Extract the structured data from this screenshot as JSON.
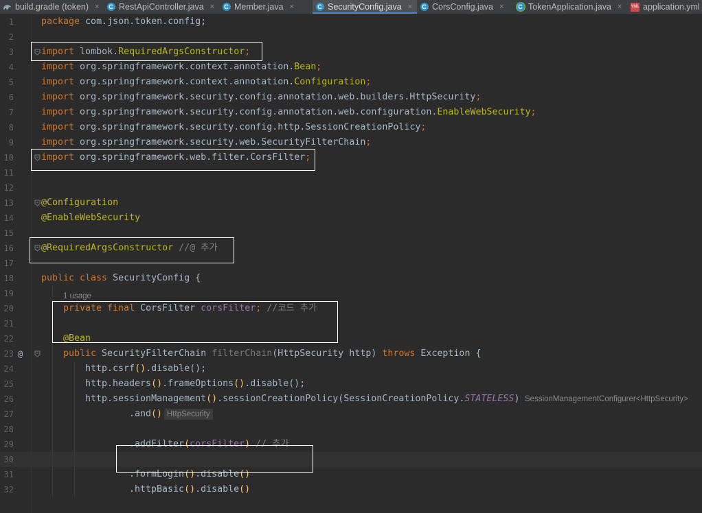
{
  "tabs": [
    {
      "label": "build.gradle (token)",
      "icon": "gradle-icon",
      "active": false
    },
    {
      "label": "RestApiController.java",
      "icon": "class-icon",
      "active": false
    },
    {
      "label": "Member.java",
      "icon": "class-icon",
      "active": false
    },
    {
      "label": "SecurityConfig.java",
      "icon": "class-icon",
      "active": true
    },
    {
      "label": "CorsConfig.java",
      "icon": "class-icon",
      "active": false
    },
    {
      "label": "TokenApplication.java",
      "icon": "spring-boot-class-icon",
      "active": false
    },
    {
      "label": "application.yml",
      "icon": "yml-file-icon",
      "active": false
    }
  ],
  "close_glyph": "×",
  "class_icon_letter": "C",
  "yml_icon_text": "YML",
  "gutter_at_symbol": "@",
  "editor": {
    "line_numbers": [
      "1",
      "2",
      "3",
      "4",
      "5",
      "6",
      "7",
      "8",
      "9",
      "10",
      "11",
      "12",
      "13",
      "14",
      "15",
      "16",
      "17",
      "18",
      "19",
      "20",
      "21",
      "22",
      "23",
      "24",
      "25",
      "26",
      "27",
      "28",
      "29",
      "30",
      "31",
      "32"
    ],
    "usage_hint": "1 usage",
    "inlay_hints": {
      "session_type": "SessionManagementConfigurer<HttpSecurity>",
      "and_type": "HttpSecurity"
    },
    "code": {
      "l1": [
        "package",
        " com.json.token.config;"
      ],
      "l3": [
        "import",
        " lombok.",
        "RequiredArgsConstructor",
        ";"
      ],
      "l4": [
        "import",
        " org.springframework.context.annotation.",
        "Bean",
        ";"
      ],
      "l5": [
        "import",
        " org.springframework.context.annotation.",
        "Configuration",
        ";"
      ],
      "l6": [
        "import",
        " org.springframework.security.config.annotation.web.builders.HttpSecurity",
        ";"
      ],
      "l7": [
        "import",
        " org.springframework.security.config.annotation.web.configuration.",
        "EnableWebSecurity",
        ";"
      ],
      "l8": [
        "import",
        " org.springframework.security.config.http.SessionCreationPolicy",
        ";"
      ],
      "l9": [
        "import",
        " org.springframework.security.web.SecurityFilterChain",
        ";"
      ],
      "l10": [
        "import",
        " org.springframework.web.filter.CorsFilter",
        ";"
      ],
      "l13": [
        "@Configuration"
      ],
      "l14": [
        "@EnableWebSecurity"
      ],
      "l16": [
        "@RequiredArgsConstructor",
        " //@ 추가"
      ],
      "l18": [
        "public class",
        " SecurityConfig {"
      ],
      "l20": [
        "private final",
        " CorsFilter ",
        "corsFilter",
        "; ",
        "//코드 추가"
      ],
      "l22": [
        "@Bean"
      ],
      "l23": [
        "public",
        " SecurityFilterChain ",
        "filterChain",
        "(HttpSecurity http) ",
        "throws",
        " Exception {"
      ],
      "l24": [
        "http.csrf",
        "()",
        ".disable",
        "();"
      ],
      "l25": [
        "http.headers",
        "()",
        ".frameOptions",
        "()",
        ".disable",
        "();"
      ],
      "l26": [
        "http.sessionManagement",
        "()",
        ".sessionCreationPolicy",
        "(SessionCreationPolicy.",
        "STATELESS",
        ")"
      ],
      "l27": [
        ".and",
        "()"
      ],
      "l29": [
        ".addFilter",
        "(",
        "corsFilter",
        ") ",
        "// 추가"
      ],
      "l31": [
        ".formLogin",
        "()",
        ".disable",
        "()"
      ],
      "l32": [
        ".httpBasic",
        "()",
        ".disable",
        "()"
      ]
    }
  },
  "colors": {
    "background": "#2b2b2b",
    "keyword": "#cc7832",
    "annotation": "#bbb529",
    "field": "#9876aa",
    "comment": "#808080",
    "plain": "#a9b7c6",
    "highlight_box": "#ffffff"
  }
}
